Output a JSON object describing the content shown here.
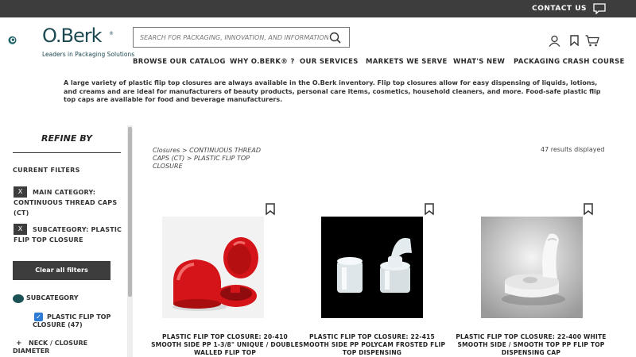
{
  "topbar": {
    "contact_label": "CONTACT US",
    "chat_icon": "chat-icon"
  },
  "brand": {
    "name": "O.Berk",
    "registered": "®",
    "tagline": "Leaders in Packaging Solutions"
  },
  "search": {
    "placeholder": "SEARCH FOR PACKAGING, INNOVATION, AND INFORMATION",
    "value": "",
    "icon": "search-icon"
  },
  "header_icons": [
    "user-icon",
    "bookmark-icon",
    "cart-icon"
  ],
  "nav": [
    "BROWSE OUR CATALOG",
    "WHY O.BERK® ?",
    "OUR SERVICES",
    "MARKETS WE SERVE",
    "WHAT'S NEW",
    "PACKAGING CRASH COURSE"
  ],
  "intro": "A large variety of plastic flip top closures are always available in the O.Berk inventory. Flip top closures allow for easy dispensing of liquids, lotions, and creams and are ideal for manufacturers of beauty products, personal care items, cosmetics, household cleaners, and more. Food-safe plastic flip top caps are available for food and beverage manufacturers.",
  "sidebar": {
    "refine_title": "REFINE BY",
    "current_filters_label": "CURRENT FILTERS",
    "filters": [
      {
        "remove": "X",
        "text": "MAIN CATEGORY: CONTINUOUS THREAD CAPS (CT)"
      },
      {
        "remove": "X",
        "text": "SUBCATEGORY: PLASTIC FLIP TOP CLOSURE"
      }
    ],
    "clear_label": "Clear all filters",
    "subcategory_label": "SUBCATEGORY",
    "subcategory_option": {
      "label": "PLASTIC FLIP TOP CLOSURE (47)",
      "checked": true
    },
    "neck_toggle": "+",
    "neck_label": "NECK / CLOSURE DIAMETER"
  },
  "breadcrumb": "Closures > CONTINUOUS THREAD CAPS (CT) > PLASTIC FLIP TOP CLOSURE",
  "results_count": "47 results displayed",
  "products": [
    {
      "title": "PLASTIC FLIP TOP CLOSURE: 20-410 SMOOTH SIDE PP 1-3/8\" UNIQUE / DOUBLE WALLED FLIP TOP",
      "image": "red-flip-top-closure"
    },
    {
      "title": "PLASTIC FLIP TOP CLOSURE: 22-415 SMOOTH SIDE PP POLYCAM FROSTED FLIP TOP DISPENSING",
      "image": "frosted-flip-top-closure"
    },
    {
      "title": "PLASTIC FLIP TOP CLOSURE: 22-400 WHITE SMOOTH SIDE / SMOOTH TOP PP FLIP TOP DISPENSING CAP",
      "image": "white-flip-top-closure"
    }
  ],
  "colors": {
    "topbar": "#3d3d3d",
    "brand": "#1d4a52",
    "accent": "#1b5256",
    "checkbox": "#2d7bd4"
  }
}
